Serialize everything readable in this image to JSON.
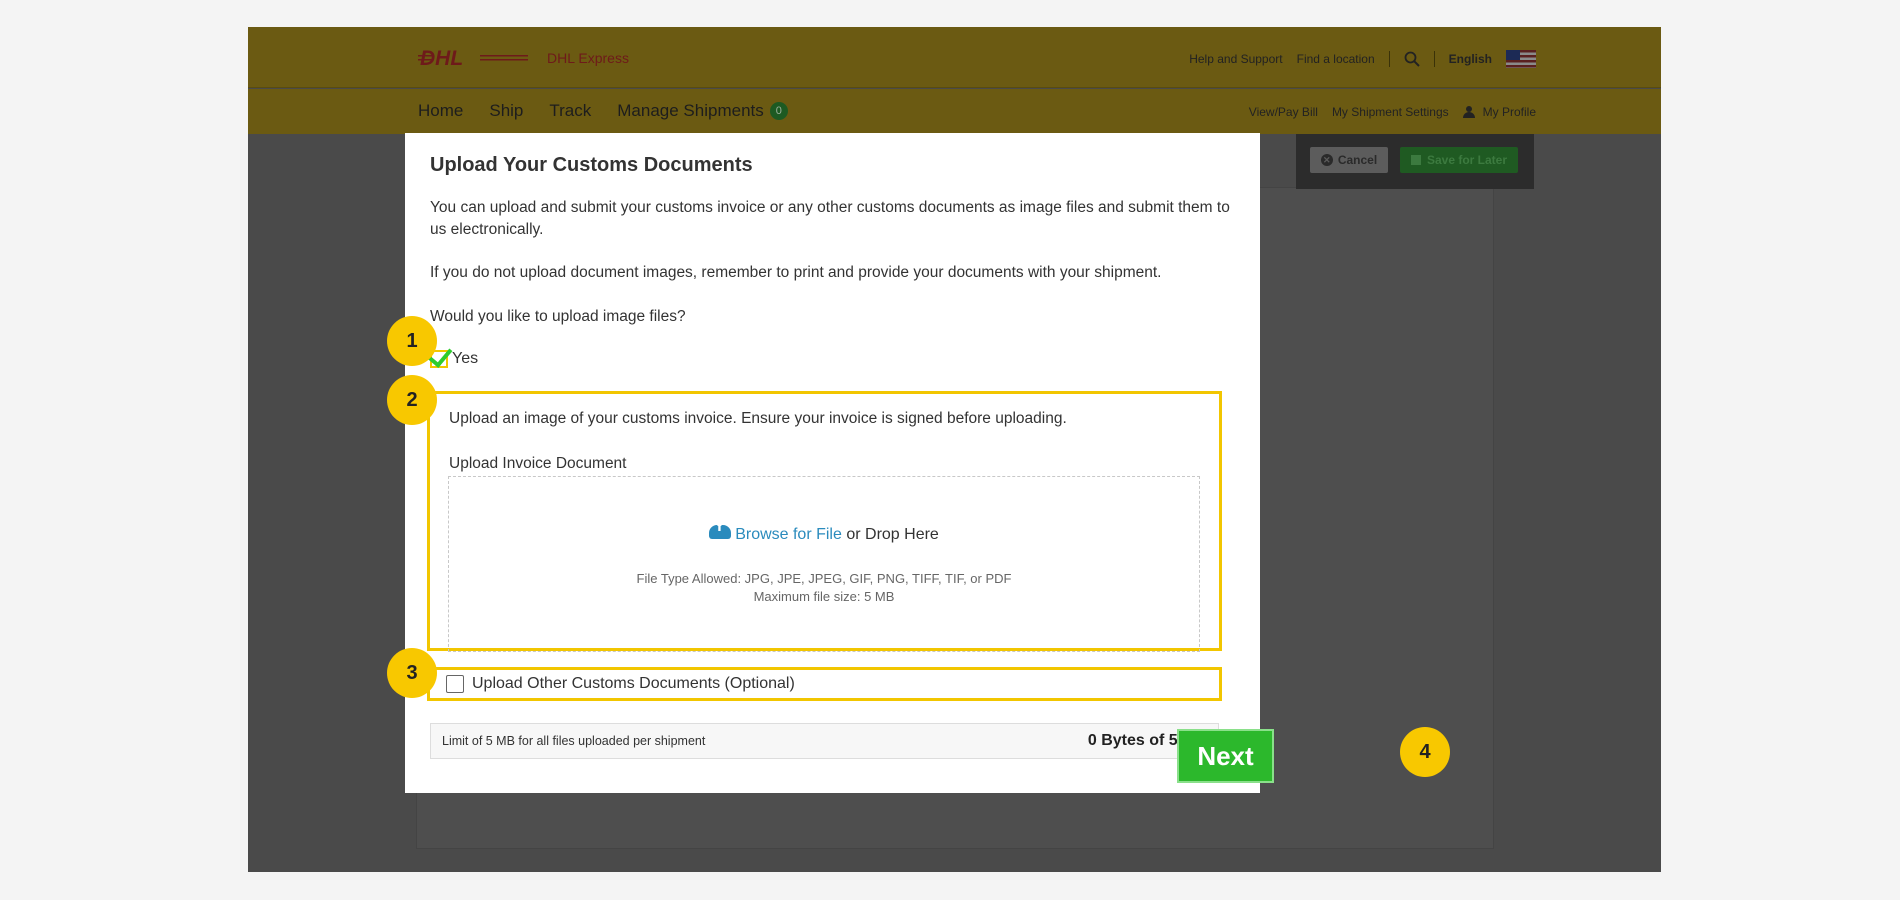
{
  "header": {
    "logo_text": "DHL",
    "brand_sub": "DHL Express",
    "help_link": "Help and Support",
    "location_link": "Find a location",
    "language": "English",
    "nav": [
      {
        "label": "Home"
      },
      {
        "label": "Ship"
      },
      {
        "label": "Track"
      },
      {
        "label": "Manage Shipments"
      }
    ],
    "manage_badge": "0",
    "view_pay_bill": "View/Pay Bill",
    "shipment_settings": "My Shipment Settings",
    "my_profile": "My Profile"
  },
  "action_bar": {
    "cancel_label": "Cancel",
    "save_label": "Save for Later"
  },
  "modal": {
    "title": "Upload Your Customs Documents",
    "intro": "You can upload and submit your customs invoice or any other customs documents as image files and submit them to us electronically.",
    "reminder": "If you do not upload document images, remember to print and provide your documents with your shipment.",
    "question": "Would you like to upload image files?",
    "yes_label": "Yes",
    "yes_checked": true,
    "invoice_instruction": "Upload an image of your customs invoice. Ensure your invoice is signed before uploading.",
    "upload_label": "Upload Invoice Document",
    "browse_label": "Browse for File",
    "drop_label": " or Drop Here",
    "file_types": "File Type Allowed: JPG, JPE, JPEG, GIF, PNG, TIFF, TIF, or PDF",
    "max_size": "Maximum file size: 5 MB",
    "other_docs_label": "Upload Other Customs Documents (Optional)",
    "other_docs_checked": false,
    "limit_text": "Limit of 5 MB for all files uploaded per shipment",
    "usage_text": "0 Bytes of 5 MB"
  },
  "next_label": "Next",
  "steps": [
    "1",
    "2",
    "3",
    "4"
  ],
  "colors": {
    "highlight": "#f2c600",
    "step_badge": "#f8c800",
    "next_green": "#2cb82c",
    "link_blue": "#2a8bbd"
  },
  "icons": [
    "search-icon",
    "flag-icon",
    "user-icon",
    "cancel-icon",
    "save-icon",
    "cloud-upload-icon",
    "checkmark-icon"
  ]
}
